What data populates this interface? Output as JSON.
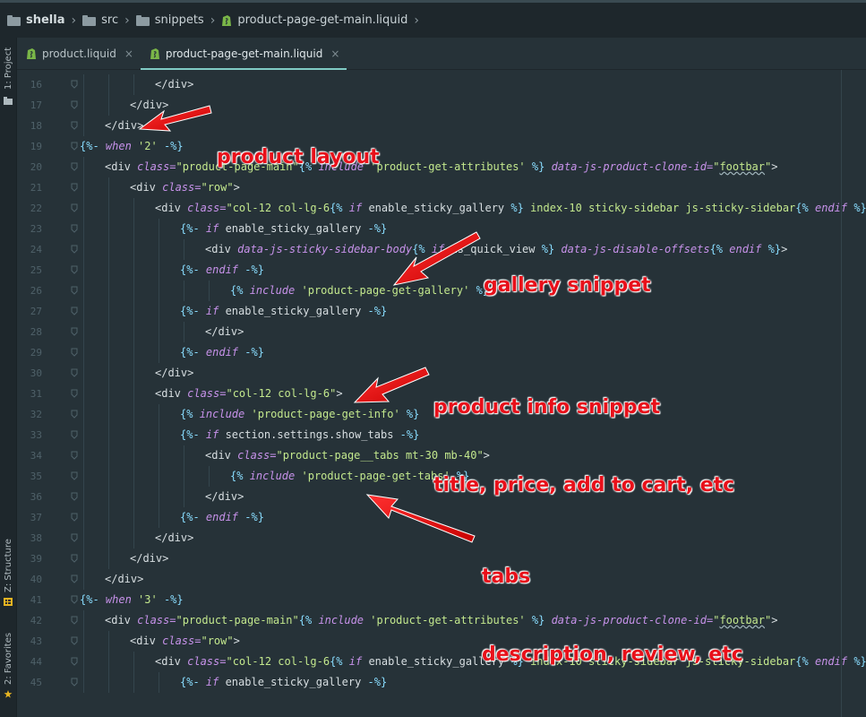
{
  "breadcrumb": [
    {
      "label": "shella",
      "icon": "folder-icon"
    },
    {
      "label": "src",
      "icon": "folder-icon"
    },
    {
      "label": "snippets",
      "icon": "folder-icon"
    },
    {
      "label": "product-page-get-main.liquid",
      "icon": "liquid-file-icon"
    }
  ],
  "tool_windows": {
    "project": "1: Project",
    "structure": "Z: Structure",
    "favorites": "2: Favorites"
  },
  "tabs": [
    {
      "label": "product.liquid",
      "close": "×",
      "active": false
    },
    {
      "label": "product-page-get-main.liquid",
      "close": "×",
      "active": true
    }
  ],
  "colors": {
    "background": "#263238",
    "accent": "#80cbc4",
    "liquid_icon": "#7ab648",
    "annotation": "#e8101a"
  },
  "code_lines": [
    {
      "n": "16",
      "indent": 3,
      "t": [
        [
          "t-tag",
          "</div>"
        ]
      ]
    },
    {
      "n": "17",
      "indent": 2,
      "t": [
        [
          "t-tag",
          "</div>"
        ]
      ]
    },
    {
      "n": "18",
      "indent": 1,
      "t": [
        [
          "t-tag",
          "</div>"
        ]
      ]
    },
    {
      "n": "19",
      "indent": 0,
      "t": [
        [
          "t-liq",
          "{%- "
        ],
        [
          "t-kw",
          "when"
        ],
        [
          "t-plain",
          " "
        ],
        [
          "t-str",
          "'2'"
        ],
        [
          "t-liq",
          " -%}"
        ]
      ]
    },
    {
      "n": "20",
      "indent": 1,
      "t": [
        [
          "t-tag",
          "<div "
        ],
        [
          "t-attr",
          "class="
        ],
        [
          "t-str",
          "\"product-page-main\""
        ],
        [
          "t-liq",
          "{% "
        ],
        [
          "t-kw",
          "include"
        ],
        [
          "t-plain",
          " "
        ],
        [
          "t-str",
          "'product-get-attributes'"
        ],
        [
          "t-liq",
          " %}"
        ],
        [
          "t-plain",
          " "
        ],
        [
          "t-attr",
          "data-js-product-clone-id="
        ],
        [
          "t-str",
          "\""
        ],
        [
          "t-str t-squig",
          "footbar"
        ],
        [
          "t-str",
          "\""
        ],
        [
          "t-tag",
          ">"
        ]
      ]
    },
    {
      "n": "21",
      "indent": 2,
      "t": [
        [
          "t-tag",
          "<div "
        ],
        [
          "t-attr",
          "class="
        ],
        [
          "t-str",
          "\"row\""
        ],
        [
          "t-tag",
          ">"
        ]
      ]
    },
    {
      "n": "22",
      "indent": 3,
      "t": [
        [
          "t-tag",
          "<div "
        ],
        [
          "t-attr",
          "class="
        ],
        [
          "t-str",
          "\"col-12 col-lg-6"
        ],
        [
          "t-liq",
          "{% "
        ],
        [
          "t-kw",
          "if"
        ],
        [
          "t-var",
          " enable_sticky_gallery "
        ],
        [
          "t-liq",
          "%}"
        ],
        [
          "t-str",
          " index-10 sticky-sidebar js-sticky-sidebar"
        ],
        [
          "t-liq",
          "{% "
        ],
        [
          "t-kw",
          "endif"
        ],
        [
          "t-liq",
          " %}"
        ],
        [
          "t-str",
          "\""
        ],
        [
          "t-tag",
          ">"
        ]
      ]
    },
    {
      "n": "23",
      "indent": 4,
      "t": [
        [
          "t-liq",
          "{%- "
        ],
        [
          "t-kw",
          "if"
        ],
        [
          "t-var",
          " enable_sticky_gallery "
        ],
        [
          "t-liq",
          "-%}"
        ]
      ]
    },
    {
      "n": "24",
      "indent": 5,
      "t": [
        [
          "t-tag",
          "<div "
        ],
        [
          "t-attr",
          "data-js-sticky-sidebar-body"
        ],
        [
          "t-liq",
          "{% "
        ],
        [
          "t-kw",
          "if"
        ],
        [
          "t-var",
          " is_quick_view "
        ],
        [
          "t-liq",
          "%}"
        ],
        [
          "t-plain",
          " "
        ],
        [
          "t-attr",
          "data-js-disable-offsets"
        ],
        [
          "t-liq",
          "{% "
        ],
        [
          "t-kw",
          "endif"
        ],
        [
          "t-liq",
          " %}"
        ],
        [
          "t-tag",
          ">"
        ]
      ]
    },
    {
      "n": "25",
      "indent": 4,
      "t": [
        [
          "t-liq",
          "{%- "
        ],
        [
          "t-kw",
          "endif"
        ],
        [
          "t-liq",
          " -%}"
        ]
      ]
    },
    {
      "n": "26",
      "indent": 6,
      "t": [
        [
          "t-liq",
          "{% "
        ],
        [
          "t-kw",
          "include"
        ],
        [
          "t-plain",
          " "
        ],
        [
          "t-str",
          "'product-page-get-gallery'"
        ],
        [
          "t-liq",
          " %}"
        ]
      ]
    },
    {
      "n": "27",
      "indent": 4,
      "t": [
        [
          "t-liq",
          "{%- "
        ],
        [
          "t-kw",
          "if"
        ],
        [
          "t-var",
          " enable_sticky_gallery "
        ],
        [
          "t-liq",
          "-%}"
        ]
      ]
    },
    {
      "n": "28",
      "indent": 5,
      "t": [
        [
          "t-tag",
          "</div>"
        ]
      ]
    },
    {
      "n": "29",
      "indent": 4,
      "t": [
        [
          "t-liq",
          "{%- "
        ],
        [
          "t-kw",
          "endif"
        ],
        [
          "t-liq",
          " -%}"
        ]
      ]
    },
    {
      "n": "30",
      "indent": 3,
      "t": [
        [
          "t-tag",
          "</div>"
        ]
      ]
    },
    {
      "n": "31",
      "indent": 3,
      "t": [
        [
          "t-tag",
          "<div "
        ],
        [
          "t-attr",
          "class="
        ],
        [
          "t-str",
          "\"col-12 col-lg-6\""
        ],
        [
          "t-tag",
          ">"
        ]
      ]
    },
    {
      "n": "32",
      "indent": 4,
      "t": [
        [
          "t-liq",
          "{% "
        ],
        [
          "t-kw",
          "include"
        ],
        [
          "t-plain",
          " "
        ],
        [
          "t-str",
          "'product-page-get-info'"
        ],
        [
          "t-liq",
          " %}"
        ]
      ]
    },
    {
      "n": "33",
      "indent": 4,
      "t": [
        [
          "t-liq",
          "{%- "
        ],
        [
          "t-kw",
          "if"
        ],
        [
          "t-var",
          " section.settings.show_tabs "
        ],
        [
          "t-liq",
          "-%}"
        ]
      ]
    },
    {
      "n": "34",
      "indent": 5,
      "t": [
        [
          "t-tag",
          "<div "
        ],
        [
          "t-attr",
          "class="
        ],
        [
          "t-str",
          "\"product-page__tabs mt-30 mb-40\""
        ],
        [
          "t-tag",
          ">"
        ]
      ]
    },
    {
      "n": "35",
      "indent": 6,
      "t": [
        [
          "t-liq",
          "{% "
        ],
        [
          "t-kw",
          "include"
        ],
        [
          "t-plain",
          " "
        ],
        [
          "t-str",
          "'product-page-get-tabs'"
        ],
        [
          "t-liq",
          " %}"
        ]
      ]
    },
    {
      "n": "36",
      "indent": 5,
      "t": [
        [
          "t-tag",
          "</div>"
        ]
      ]
    },
    {
      "n": "37",
      "indent": 4,
      "t": [
        [
          "t-liq",
          "{%- "
        ],
        [
          "t-kw",
          "endif"
        ],
        [
          "t-liq",
          " -%}"
        ]
      ]
    },
    {
      "n": "38",
      "indent": 3,
      "t": [
        [
          "t-tag",
          "</div>"
        ]
      ]
    },
    {
      "n": "39",
      "indent": 2,
      "t": [
        [
          "t-tag",
          "</div>"
        ]
      ]
    },
    {
      "n": "40",
      "indent": 1,
      "t": [
        [
          "t-tag",
          "</div>"
        ]
      ]
    },
    {
      "n": "41",
      "indent": 0,
      "t": [
        [
          "t-liq",
          "{%- "
        ],
        [
          "t-kw",
          "when"
        ],
        [
          "t-plain",
          " "
        ],
        [
          "t-str",
          "'3'"
        ],
        [
          "t-liq",
          " -%}"
        ]
      ]
    },
    {
      "n": "42",
      "indent": 1,
      "t": [
        [
          "t-tag",
          "<div "
        ],
        [
          "t-attr",
          "class="
        ],
        [
          "t-str",
          "\"product-page-main\""
        ],
        [
          "t-liq",
          "{% "
        ],
        [
          "t-kw",
          "include"
        ],
        [
          "t-plain",
          " "
        ],
        [
          "t-str",
          "'product-get-attributes'"
        ],
        [
          "t-liq",
          " %}"
        ],
        [
          "t-plain",
          " "
        ],
        [
          "t-attr",
          "data-js-product-clone-id="
        ],
        [
          "t-str",
          "\""
        ],
        [
          "t-str t-squig",
          "footbar"
        ],
        [
          "t-str",
          "\""
        ],
        [
          "t-tag",
          ">"
        ]
      ]
    },
    {
      "n": "43",
      "indent": 2,
      "t": [
        [
          "t-tag",
          "<div "
        ],
        [
          "t-attr",
          "class="
        ],
        [
          "t-str",
          "\"row\""
        ],
        [
          "t-tag",
          ">"
        ]
      ]
    },
    {
      "n": "44",
      "indent": 3,
      "t": [
        [
          "t-tag",
          "<div "
        ],
        [
          "t-attr",
          "class="
        ],
        [
          "t-str",
          "\"col-12 col-lg-6"
        ],
        [
          "t-liq",
          "{% "
        ],
        [
          "t-kw",
          "if"
        ],
        [
          "t-var",
          " enable_sticky_gallery "
        ],
        [
          "t-liq",
          "%}"
        ],
        [
          "t-str",
          " index-10 sticky-sidebar js-sticky-sidebar"
        ],
        [
          "t-liq",
          "{% "
        ],
        [
          "t-kw",
          "endif"
        ],
        [
          "t-liq",
          " %}"
        ],
        [
          "t-str",
          "\""
        ],
        [
          "t-tag",
          ">"
        ]
      ]
    },
    {
      "n": "45",
      "indent": 4,
      "t": [
        [
          "t-liq",
          "{%- "
        ],
        [
          "t-kw",
          "if"
        ],
        [
          "t-var",
          " enable_sticky_gallery "
        ],
        [
          "t-liq",
          "-%}"
        ]
      ]
    }
  ],
  "annotations": [
    {
      "id": "product-layout",
      "lines": [
        "product layout"
      ]
    },
    {
      "id": "gallery-snippet",
      "lines": [
        "gallery snippet"
      ]
    },
    {
      "id": "product-info-snippet",
      "lines": [
        "product info snippet",
        "title, price, add to cart, etc"
      ]
    },
    {
      "id": "tabs",
      "lines": [
        "tabs",
        "description, review, etc"
      ]
    }
  ]
}
